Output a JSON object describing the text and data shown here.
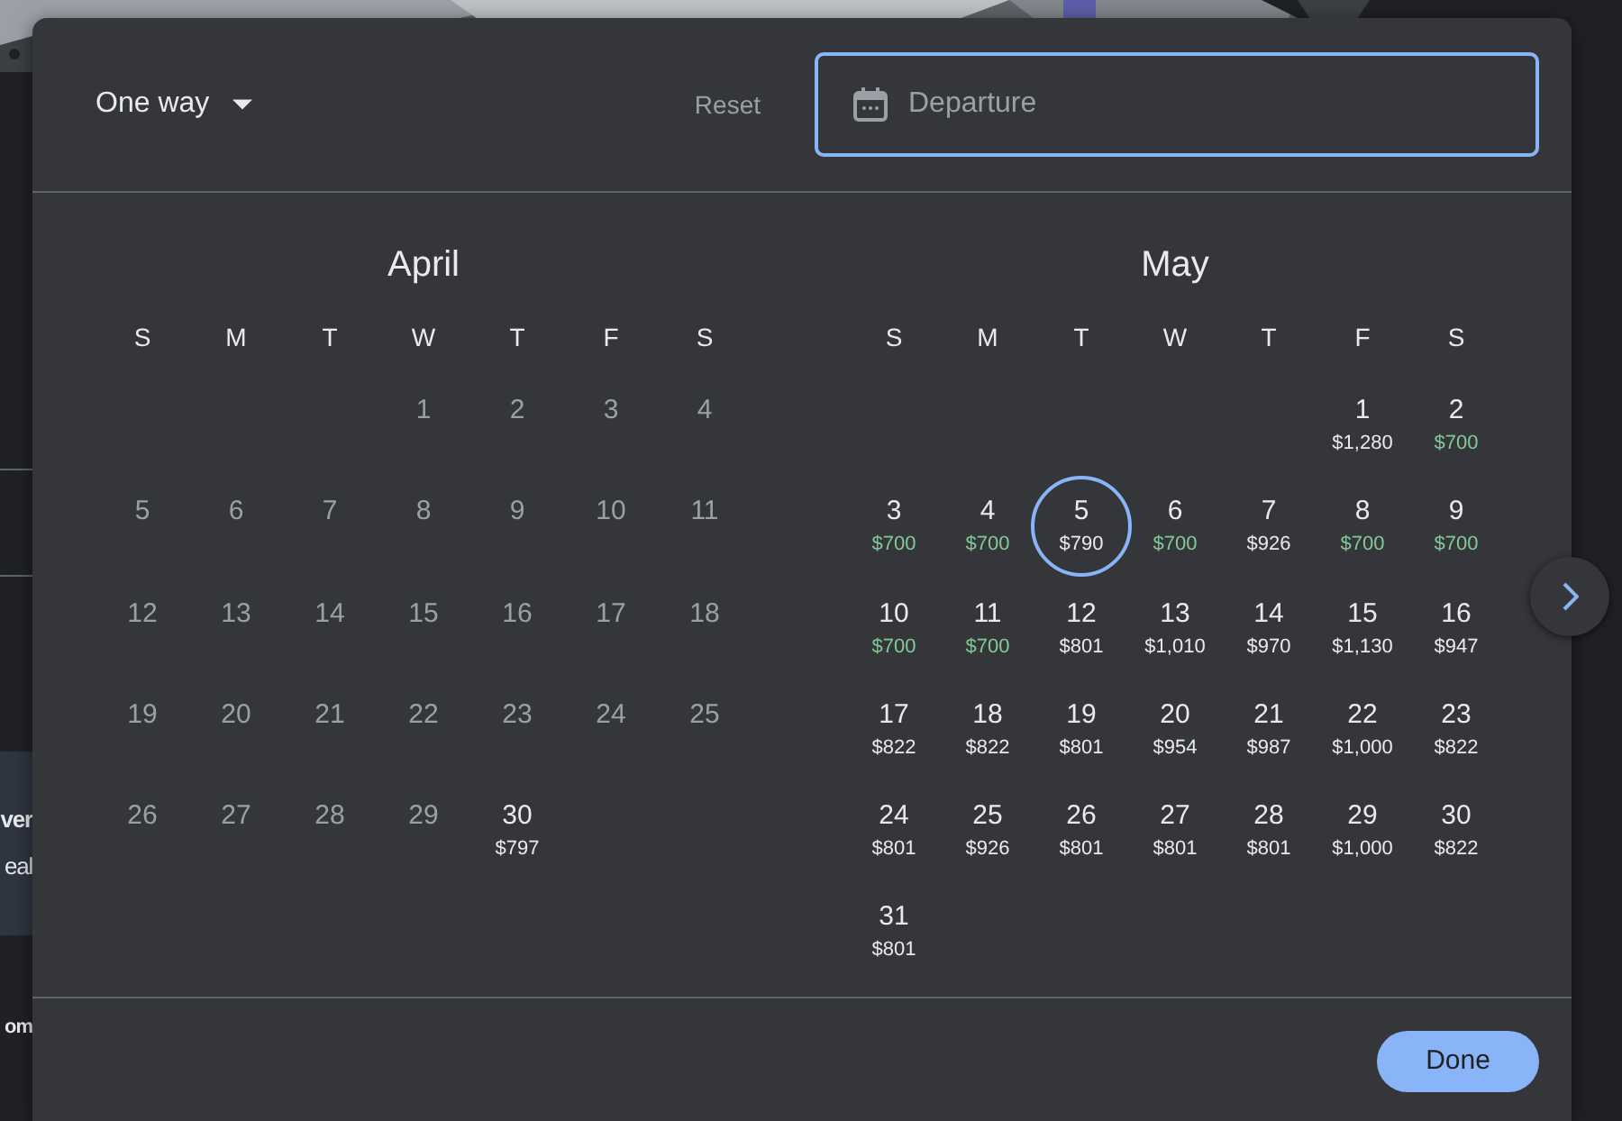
{
  "background": {
    "banner": {
      "title": "ver",
      "text": "eal"
    },
    "heading": "om"
  },
  "trip_type": {
    "label": "One way"
  },
  "reset": "Reset",
  "departure": {
    "placeholder": "Departure"
  },
  "months": [
    {
      "name": "April",
      "weekdays": [
        "S",
        "M",
        "T",
        "W",
        "T",
        "F",
        "S"
      ],
      "weeks": [
        [
          {
            "day": "1",
            "disabled": true,
            "selected": false
          },
          {
            "day": "2",
            "disabled": true,
            "selected": false
          },
          {
            "day": "3",
            "disabled": true,
            "selected": false
          },
          {
            "day": "4",
            "disabled": true,
            "selected": false
          }
        ],
        [
          {
            "day": "5",
            "disabled": true,
            "selected": false
          },
          {
            "day": "6",
            "disabled": true,
            "selected": false
          },
          {
            "day": "7",
            "disabled": true,
            "selected": false
          },
          {
            "day": "8",
            "disabled": true,
            "selected": false
          },
          {
            "day": "9",
            "disabled": true,
            "selected": false
          },
          {
            "day": "10",
            "disabled": true,
            "selected": false
          },
          {
            "day": "11",
            "disabled": true,
            "selected": false
          }
        ],
        [
          {
            "day": "12",
            "disabled": true,
            "selected": false
          },
          {
            "day": "13",
            "disabled": true,
            "selected": false
          },
          {
            "day": "14",
            "disabled": true,
            "selected": false
          },
          {
            "day": "15",
            "disabled": true,
            "selected": false
          },
          {
            "day": "16",
            "disabled": true,
            "selected": false
          },
          {
            "day": "17",
            "disabled": true,
            "selected": false
          },
          {
            "day": "18",
            "disabled": true,
            "selected": false
          }
        ],
        [
          {
            "day": "19",
            "disabled": true,
            "selected": false
          },
          {
            "day": "20",
            "disabled": true,
            "selected": false
          },
          {
            "day": "21",
            "disabled": true,
            "selected": false
          },
          {
            "day": "22",
            "disabled": true,
            "selected": false
          },
          {
            "day": "23",
            "disabled": true,
            "selected": false
          },
          {
            "day": "24",
            "disabled": true,
            "selected": false
          },
          {
            "day": "25",
            "disabled": true,
            "selected": false
          }
        ],
        [
          {
            "day": "26",
            "disabled": true,
            "selected": false
          },
          {
            "day": "27",
            "disabled": true,
            "selected": false
          },
          {
            "day": "28",
            "disabled": true,
            "selected": false
          },
          {
            "day": "29",
            "disabled": true,
            "selected": false
          },
          {
            "day": "30",
            "price": "$797",
            "cheap": false,
            "disabled": false,
            "selected": false
          }
        ]
      ]
    },
    {
      "name": "May",
      "weekdays": [
        "S",
        "M",
        "T",
        "W",
        "T",
        "F",
        "S"
      ],
      "weeks": [
        [
          {
            "day": "1",
            "price": "$1,280",
            "cheap": false,
            "disabled": false,
            "selected": false
          },
          {
            "day": "2",
            "price": "$700",
            "cheap": true,
            "disabled": false,
            "selected": false
          }
        ],
        [
          {
            "day": "3",
            "price": "$700",
            "cheap": true,
            "disabled": false,
            "selected": false
          },
          {
            "day": "4",
            "price": "$700",
            "cheap": true,
            "disabled": false,
            "selected": false
          },
          {
            "day": "5",
            "price": "$790",
            "cheap": false,
            "disabled": false,
            "selected": true
          },
          {
            "day": "6",
            "price": "$700",
            "cheap": true,
            "disabled": false,
            "selected": false
          },
          {
            "day": "7",
            "price": "$926",
            "cheap": false,
            "disabled": false,
            "selected": false
          },
          {
            "day": "8",
            "price": "$700",
            "cheap": true,
            "disabled": false,
            "selected": false
          },
          {
            "day": "9",
            "price": "$700",
            "cheap": true,
            "disabled": false,
            "selected": false
          }
        ],
        [
          {
            "day": "10",
            "price": "$700",
            "cheap": true,
            "disabled": false,
            "selected": false
          },
          {
            "day": "11",
            "price": "$700",
            "cheap": true,
            "disabled": false,
            "selected": false
          },
          {
            "day": "12",
            "price": "$801",
            "cheap": false,
            "disabled": false,
            "selected": false
          },
          {
            "day": "13",
            "price": "$1,010",
            "cheap": false,
            "disabled": false,
            "selected": false
          },
          {
            "day": "14",
            "price": "$970",
            "cheap": false,
            "disabled": false,
            "selected": false
          },
          {
            "day": "15",
            "price": "$1,130",
            "cheap": false,
            "disabled": false,
            "selected": false
          },
          {
            "day": "16",
            "price": "$947",
            "cheap": false,
            "disabled": false,
            "selected": false
          }
        ],
        [
          {
            "day": "17",
            "price": "$822",
            "cheap": false,
            "disabled": false,
            "selected": false
          },
          {
            "day": "18",
            "price": "$822",
            "cheap": false,
            "disabled": false,
            "selected": false
          },
          {
            "day": "19",
            "price": "$801",
            "cheap": false,
            "disabled": false,
            "selected": false
          },
          {
            "day": "20",
            "price": "$954",
            "cheap": false,
            "disabled": false,
            "selected": false
          },
          {
            "day": "21",
            "price": "$987",
            "cheap": false,
            "disabled": false,
            "selected": false
          },
          {
            "day": "22",
            "price": "$1,000",
            "cheap": false,
            "disabled": false,
            "selected": false
          },
          {
            "day": "23",
            "price": "$822",
            "cheap": false,
            "disabled": false,
            "selected": false
          }
        ],
        [
          {
            "day": "24",
            "price": "$801",
            "cheap": false,
            "disabled": false,
            "selected": false
          },
          {
            "day": "25",
            "price": "$926",
            "cheap": false,
            "disabled": false,
            "selected": false
          },
          {
            "day": "26",
            "price": "$801",
            "cheap": false,
            "disabled": false,
            "selected": false
          },
          {
            "day": "27",
            "price": "$801",
            "cheap": false,
            "disabled": false,
            "selected": false
          },
          {
            "day": "28",
            "price": "$801",
            "cheap": false,
            "disabled": false,
            "selected": false
          },
          {
            "day": "29",
            "price": "$1,000",
            "cheap": false,
            "disabled": false,
            "selected": false
          },
          {
            "day": "30",
            "price": "$822",
            "cheap": false,
            "disabled": false,
            "selected": false
          }
        ],
        [
          {
            "day": "31",
            "price": "$801",
            "cheap": false,
            "disabled": false,
            "selected": false
          }
        ]
      ]
    }
  ],
  "done": "Done"
}
